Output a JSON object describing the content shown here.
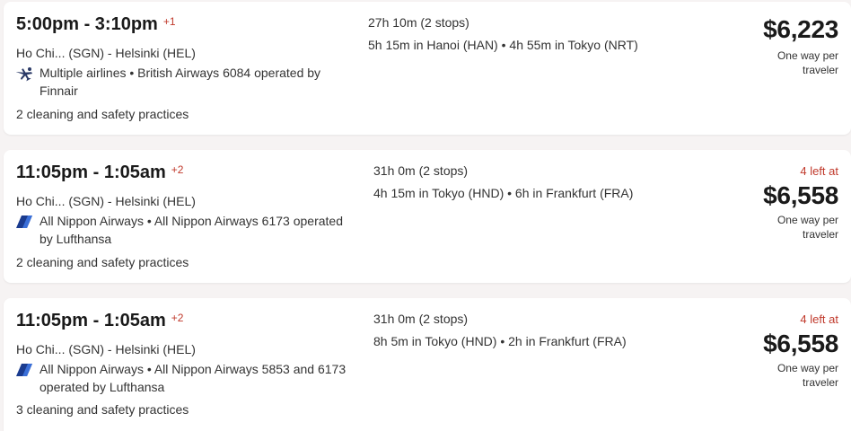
{
  "results": [
    {
      "times": "5:00pm - 3:10pm",
      "day_offset": "+1",
      "route": "Ho Chi... (SGN) - Helsinki (HEL)",
      "airline_icon": "multi-airline-plane-icon",
      "airline_line1": "Multiple airlines • British Airways 6084 operated by",
      "airline_line2": "Finnair",
      "safety": "2 cleaning and safety practices",
      "duration": "27h 10m (2 stops)",
      "layovers": "5h 15m in Hanoi (HAN) • 4h 55m in Tokyo (NRT)",
      "seats_left": "",
      "price": "$6,223",
      "price_note_line1": "One way per",
      "price_note_line2": "traveler"
    },
    {
      "times": "11:05pm - 1:05am",
      "day_offset": "+2",
      "route": "Ho Chi... (SGN) - Helsinki (HEL)",
      "airline_icon": "all-nippon-airways-logo-icon",
      "airline_line1": "All Nippon Airways • All Nippon Airways 6173 operated",
      "airline_line2": "by Lufthansa",
      "safety": "2 cleaning and safety practices",
      "duration": "31h 0m (2 stops)",
      "layovers": "4h 15m in Tokyo (HND) • 6h in Frankfurt (FRA)",
      "seats_left": "4 left at",
      "price": "$6,558",
      "price_note_line1": "One way per",
      "price_note_line2": "traveler"
    },
    {
      "times": "11:05pm - 1:05am",
      "day_offset": "+2",
      "route": "Ho Chi... (SGN) - Helsinki (HEL)",
      "airline_icon": "all-nippon-airways-logo-icon",
      "airline_line1": "All Nippon Airways • All Nippon Airways 5853 and 6173",
      "airline_line2": "operated by Lufthansa",
      "safety": "3 cleaning and safety practices",
      "duration": "31h 0m (2 stops)",
      "layovers": "8h 5m in Tokyo (HND) • 2h in Frankfurt (FRA)",
      "seats_left": "4 left at",
      "price": "$6,558",
      "price_note_line1": "One way per",
      "price_note_line2": "traveler"
    }
  ],
  "colors": {
    "accent_red": "#c0392b",
    "ana_blue": "#1a3b8f",
    "plane_navy": "#2b3a67"
  }
}
